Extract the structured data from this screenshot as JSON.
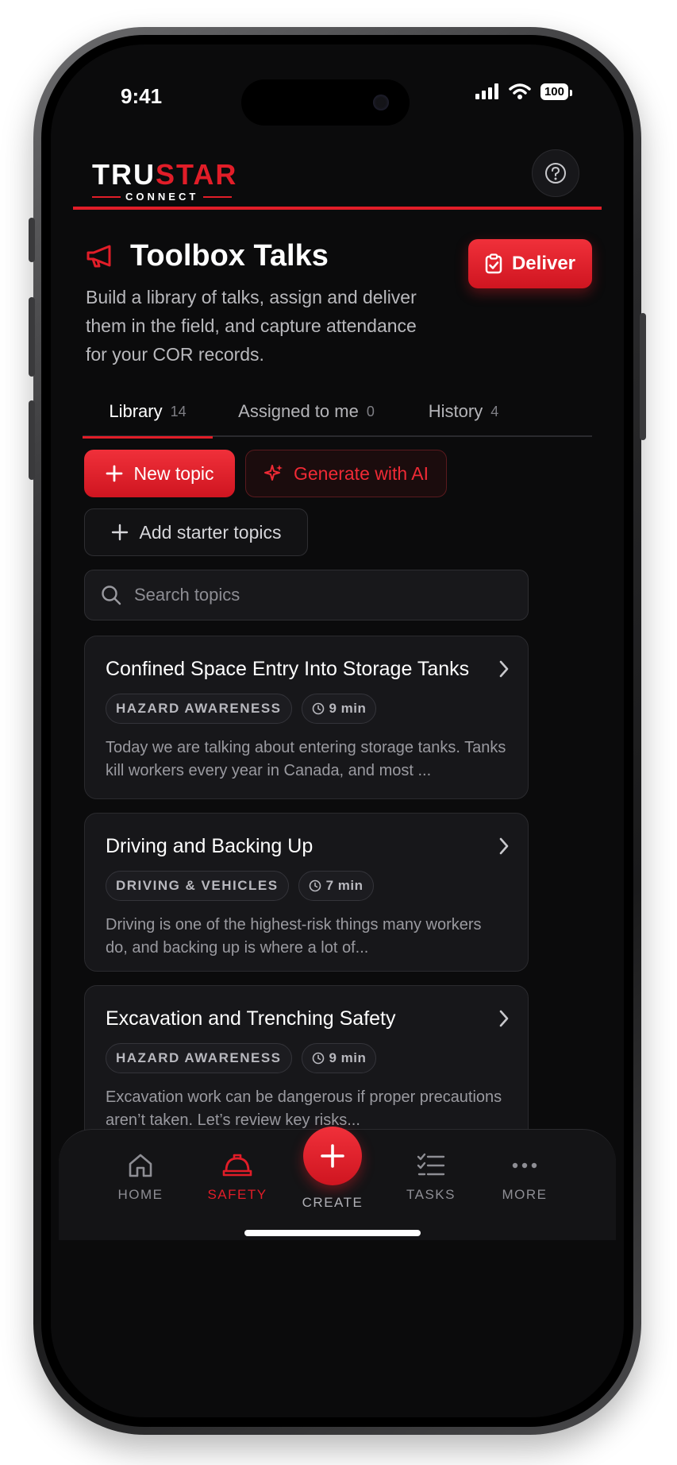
{
  "status_bar": {
    "time": "9:41",
    "battery": "100"
  },
  "brand": {
    "name_white": "TRU",
    "name_red": "STAR",
    "tagline": "CONNECT"
  },
  "page": {
    "title": "Toolbox Talks",
    "subtitle": "Build a library of talks, assign and deliver them in the field, and capture attendance for your COR records.",
    "deliver_label": "Deliver"
  },
  "tabs": [
    {
      "label": "Library",
      "count": "14"
    },
    {
      "label": "Assigned to me",
      "count": "0"
    },
    {
      "label": "History",
      "count": "4"
    }
  ],
  "actions": {
    "new_topic": "New topic",
    "generate_ai": "Generate with AI",
    "add_starter": "Add starter topics"
  },
  "search": {
    "placeholder": "Search topics"
  },
  "topics": [
    {
      "title": "Confined Space Entry Into Storage Tanks",
      "category": "HAZARD AWARENESS",
      "duration": "9 min",
      "description": "Today we are talking about entering storage tanks. Tanks kill workers every year in Canada, and most ..."
    },
    {
      "title": "Driving and Backing Up",
      "category": "DRIVING & VEHICLES",
      "duration": "7 min",
      "description": "Driving is one of the highest-risk things many workers do, and backing up is where a lot of..."
    },
    {
      "title": "Excavation and Trenching Safety",
      "category": "HAZARD AWARENESS",
      "duration": "9 min",
      "description": "Excavation work can be dangerous if proper precautions aren’t taken. Let’s review key risks..."
    }
  ],
  "nav": {
    "home": "HOME",
    "safety": "SAFETY",
    "create": "CREATE",
    "tasks": "TASKS",
    "more": "MORE"
  },
  "colors": {
    "accent": "#e11d28",
    "background": "#0b0b0c",
    "card": "#17171a"
  }
}
